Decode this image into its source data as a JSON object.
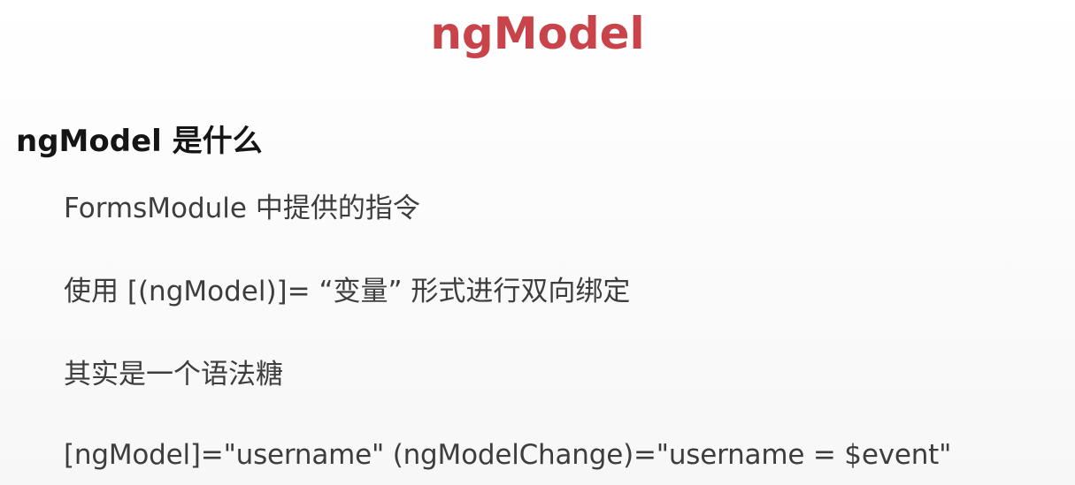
{
  "slide": {
    "title": "ngModel",
    "heading": "ngModel 是什么",
    "bullets": [
      "FormsModule 中提供的指令",
      "使用 [(ngModel)]= “变量” 形式进行双向绑定",
      "其实是一个语法糖",
      "[ngModel]=\"username\" (ngModelChange)=\"username = $event\""
    ]
  },
  "colors": {
    "title": "#c9444a",
    "heading": "#151515",
    "body_text": "#3d3d3d",
    "background": "#fbfbfb"
  }
}
